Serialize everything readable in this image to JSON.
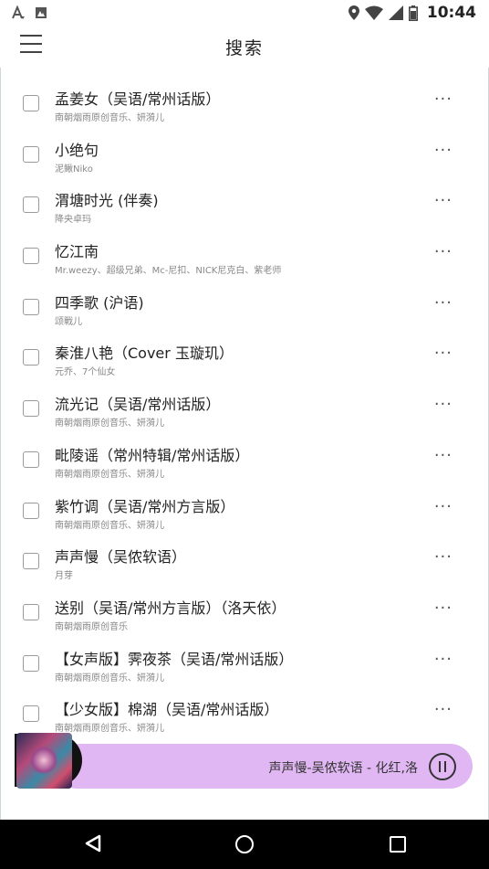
{
  "status_bar": {
    "time": "10:44"
  },
  "header": {
    "title": "搜索"
  },
  "songs": [
    {
      "title": "孟姜女（吴语/常州话版）",
      "artist": "南朝烟雨原创音乐、妍漪儿"
    },
    {
      "title": "小绝句",
      "artist": "泥鳅Niko"
    },
    {
      "title": "渭塘时光 (伴奏)",
      "artist": "降央卓玛"
    },
    {
      "title": "忆江南",
      "artist": "Mr.weezy、超级兄弟、Mc-尼扣、NICK尼克白、紫老师"
    },
    {
      "title": "四季歌 (沪语)",
      "artist": "颂戰儿"
    },
    {
      "title": "秦淮八艳（Cover 玉璇玑）",
      "artist": "元乔、7个仙女"
    },
    {
      "title": "流光记（吴语/常州话版）",
      "artist": "南朝烟雨原创音乐、妍漪儿"
    },
    {
      "title": "毗陵谣（常州特辑/常州话版）",
      "artist": "南朝烟雨原创音乐、妍漪儿"
    },
    {
      "title": "紫竹调（吴语/常州方言版）",
      "artist": "南朝烟雨原创音乐、妍漪儿"
    },
    {
      "title": "声声慢（吴侬软语）",
      "artist": "月芽"
    },
    {
      "title": "送别（吴语/常州方言版）（洛天依）",
      "artist": "南朝烟雨原创音乐"
    },
    {
      "title": "【女声版】霁夜茶（吴语/常州话版）",
      "artist": "南朝烟雨原创音乐、妍漪儿"
    },
    {
      "title": "【少女版】棉湖（吴语/常州话版）",
      "artist": "南朝烟雨原创音乐、妍漪儿"
    }
  ],
  "more_label": "···",
  "player": {
    "now_playing": "声声慢-吴侬软语 - 化红,洛"
  },
  "colors": {
    "player_bg": "#e0b7f3",
    "navbar_bg": "#000000"
  }
}
